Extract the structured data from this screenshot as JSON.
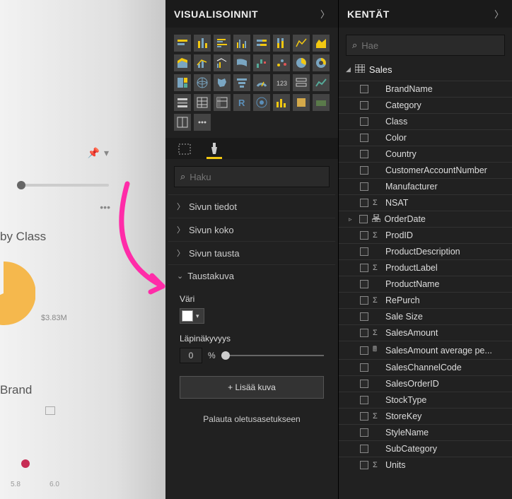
{
  "canvas": {
    "chart1_title": "by Class",
    "pie_value": "$3.83M",
    "chart2_title": "Brand",
    "axis_tick1": "5.8",
    "axis_tick2": "6.0"
  },
  "visualizations": {
    "title": "VISUALISOINNIT",
    "search_placeholder": "Haku",
    "sections": {
      "page_info": "Sivun tiedot",
      "page_size": "Sivun koko",
      "page_background": "Sivun tausta",
      "wallpaper": "Taustakuva"
    },
    "wallpaper": {
      "color_label": "Väri",
      "transparency_label": "Läpinäkyvyys",
      "transparency_value": "0",
      "transparency_unit": "%",
      "add_image": "+ Lisää kuva",
      "restore_defaults": "Palauta oletusasetukseen"
    }
  },
  "fields": {
    "title": "KENTÄT",
    "search_placeholder": "Hae",
    "table_name": "Sales",
    "items": [
      {
        "name": "BrandName",
        "icon": ""
      },
      {
        "name": "Category",
        "icon": ""
      },
      {
        "name": "Class",
        "icon": ""
      },
      {
        "name": "Color",
        "icon": ""
      },
      {
        "name": "Country",
        "icon": ""
      },
      {
        "name": "CustomerAccountNumber",
        "icon": ""
      },
      {
        "name": "Manufacturer",
        "icon": ""
      },
      {
        "name": "NSAT",
        "icon": "sigma"
      },
      {
        "name": "OrderDate",
        "icon": "hierarchy"
      },
      {
        "name": "ProdID",
        "icon": "sigma"
      },
      {
        "name": "ProductDescription",
        "icon": ""
      },
      {
        "name": "ProductLabel",
        "icon": "sigma"
      },
      {
        "name": "ProductName",
        "icon": ""
      },
      {
        "name": "RePurch",
        "icon": "sigma"
      },
      {
        "name": "Sale Size",
        "icon": ""
      },
      {
        "name": "SalesAmount",
        "icon": "sigma"
      },
      {
        "name": "SalesAmount average pe...",
        "icon": "calc"
      },
      {
        "name": "SalesChannelCode",
        "icon": ""
      },
      {
        "name": "SalesOrderID",
        "icon": ""
      },
      {
        "name": "StockType",
        "icon": ""
      },
      {
        "name": "StoreKey",
        "icon": "sigma"
      },
      {
        "name": "StyleName",
        "icon": ""
      },
      {
        "name": "SubCategory",
        "icon": ""
      },
      {
        "name": "Units",
        "icon": "sigma"
      }
    ]
  }
}
